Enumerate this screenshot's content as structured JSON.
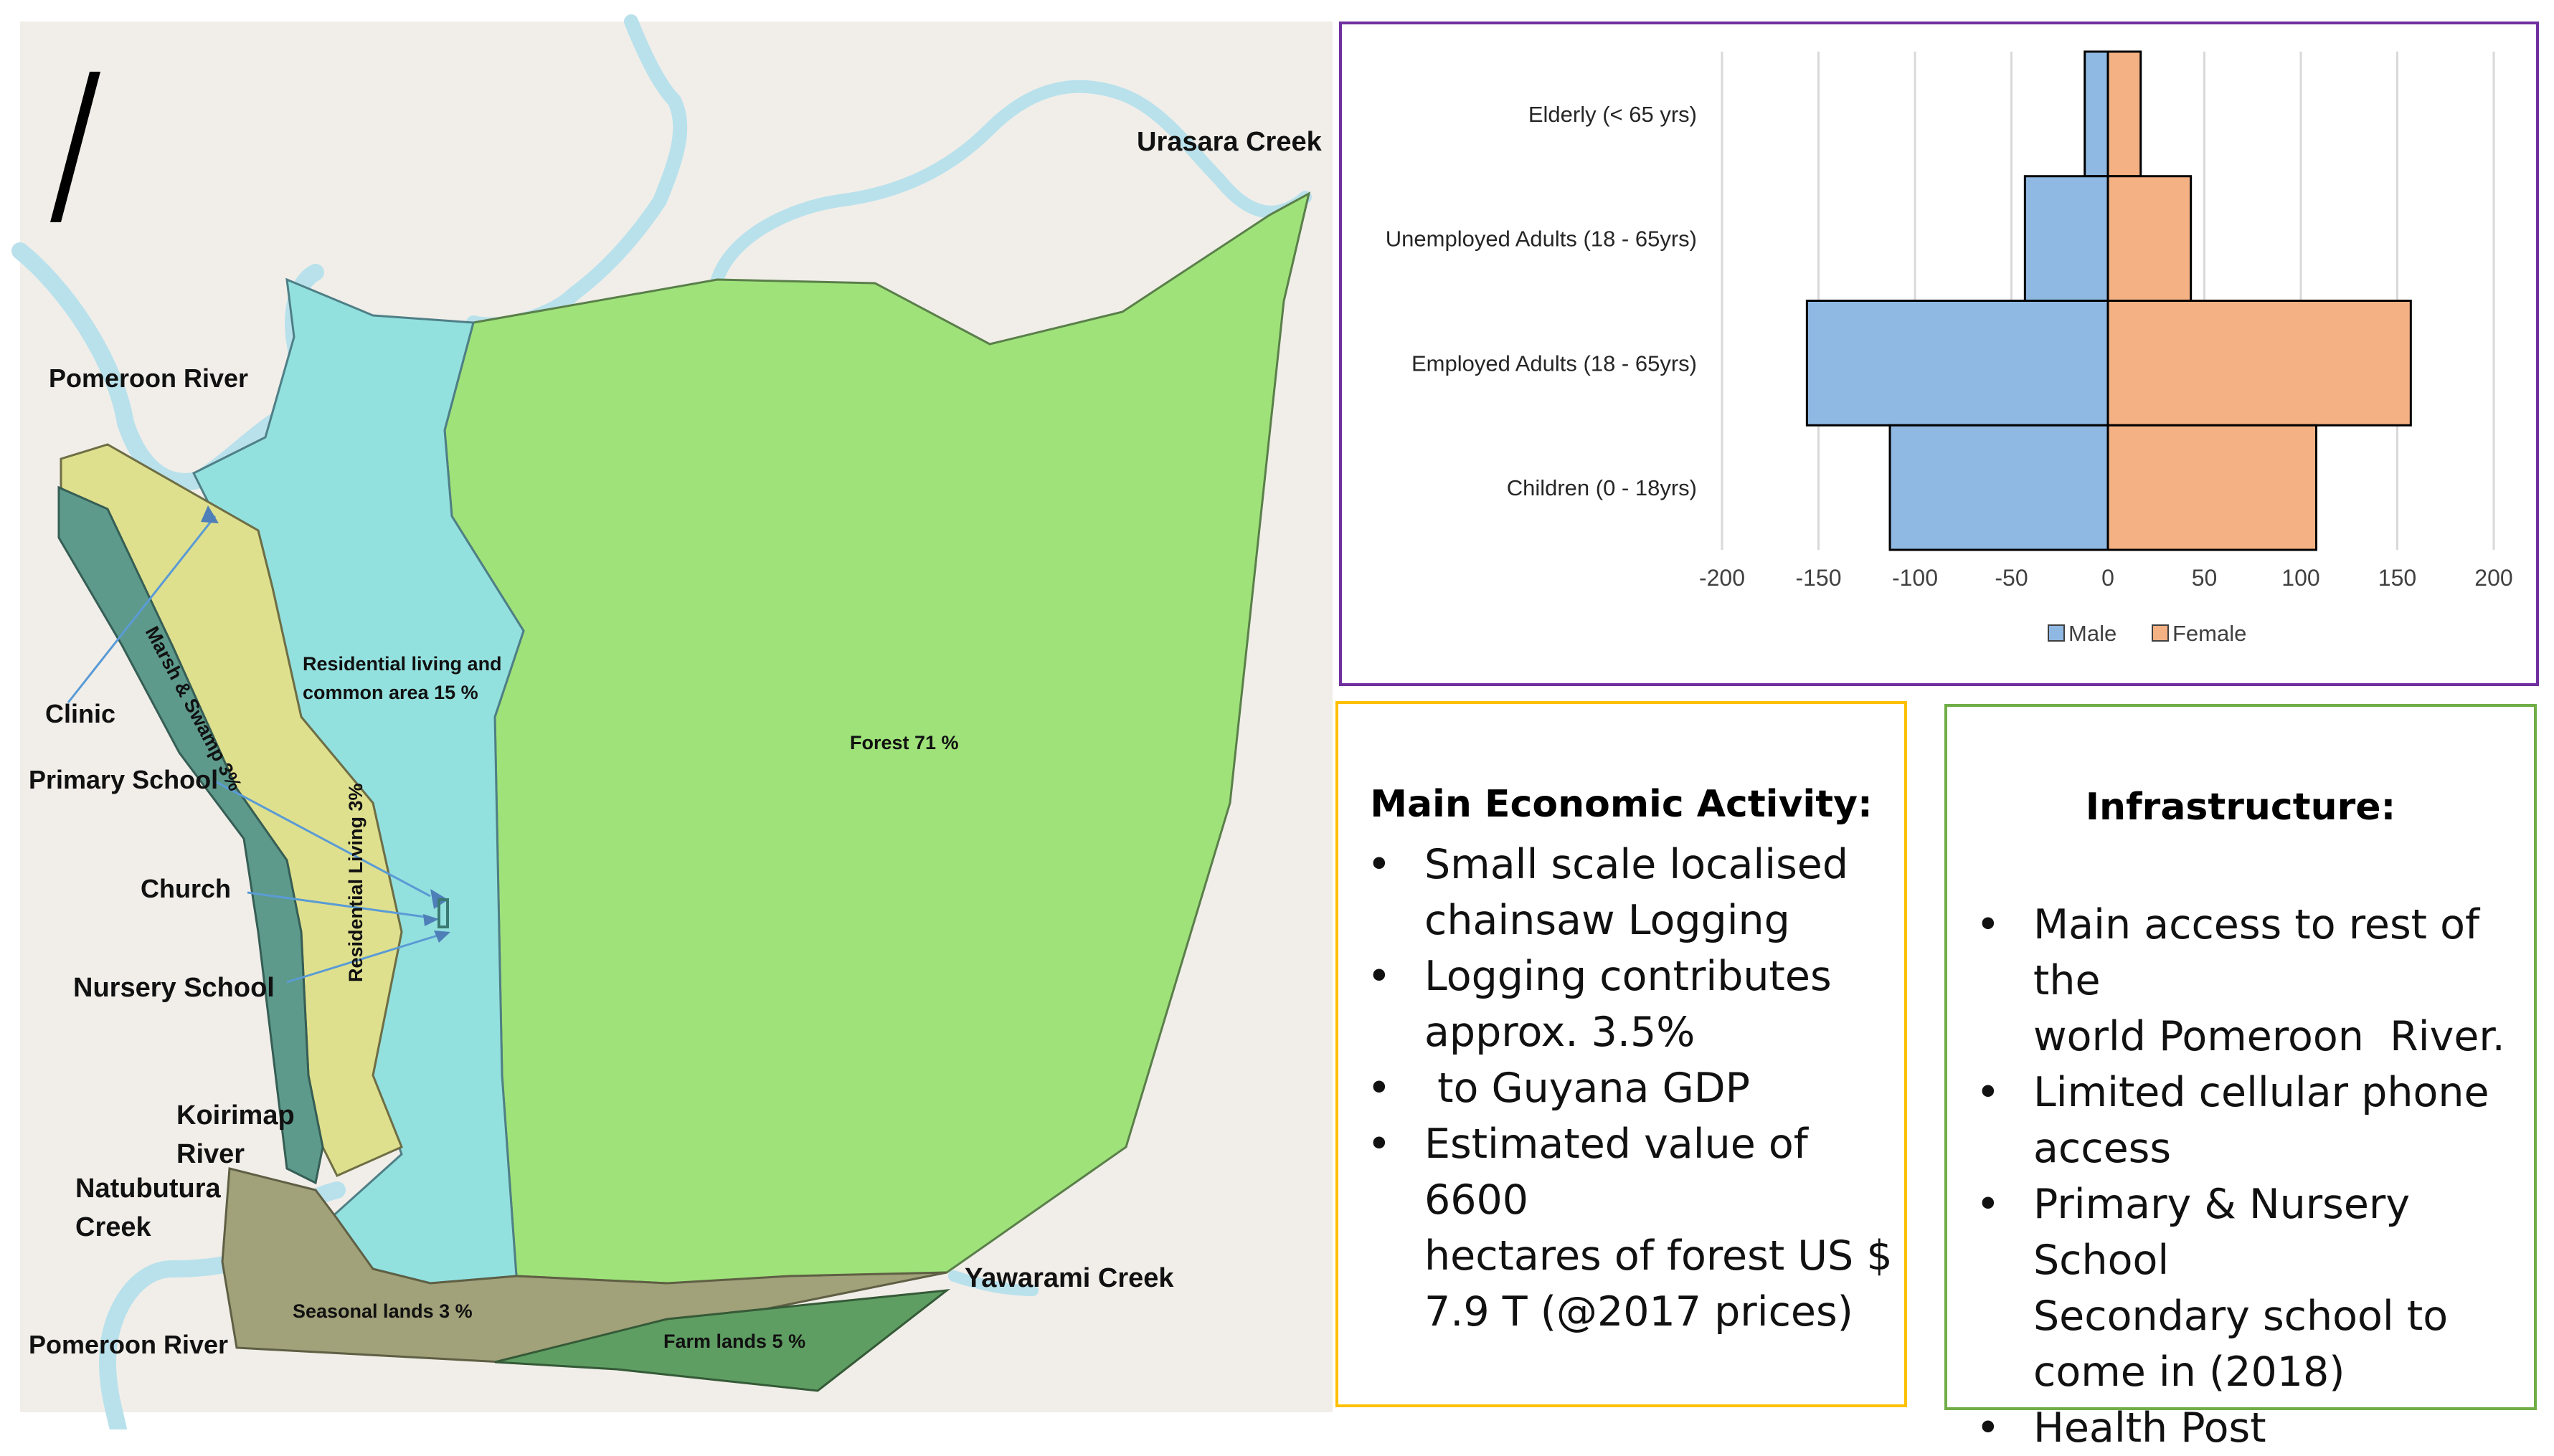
{
  "map": {
    "rivers": [
      "Pomeroon River",
      "Urasara Creek",
      "Koirimap River",
      "Natubutura Creek",
      "Yawarami Creek",
      "Pomeroon River"
    ],
    "areas": {
      "forest": "Forest 71 %",
      "residential_common": [
        "Residential living and",
        "common area 15 %"
      ],
      "residential_living": "Residential Living 3%",
      "marsh": "Marsh & Swamp 3%",
      "seasonal": "Seasonal lands 3 %",
      "farm": "Farm lands 5 %"
    },
    "facilities": [
      "Clinic",
      "Primary School",
      "Church",
      "Nursery School"
    ],
    "labels": {
      "pomeroon_top": "Pomeroon River",
      "urasara": "Urasara Creek",
      "clinic": "Clinic",
      "primary_school": "Primary School",
      "church": "Church",
      "nursery_school": "Nursery School",
      "koirimap": [
        "Koirimap",
        "River"
      ],
      "natubutura": [
        "Natubutura",
        "Creek"
      ],
      "yawarami": "Yawarami Creek",
      "pomeroon_bottom": "Pomeroon River"
    },
    "colors": {
      "forest": "#9fe27a",
      "residential_common": "#93e1df",
      "residential_living": "#dfe08e",
      "marsh": "#5d9a8b",
      "seasonal": "#a1a17a",
      "farm": "#5f9e63",
      "river": "#b9e1ec",
      "background": "#f1eee9"
    }
  },
  "chart_data": {
    "type": "bar",
    "orientation": "horizontal",
    "categories": [
      "Elderly (< 65 yrs)",
      "Unemployed Adults (18 - 65yrs)",
      "Employed Adults (18 - 65yrs)",
      "Children (0 - 18yrs)"
    ],
    "series": [
      {
        "name": "Male",
        "values": [
          -12,
          -43,
          -156,
          -113
        ],
        "color": "#8fb9e3"
      },
      {
        "name": "Female",
        "values": [
          17,
          43,
          157,
          108
        ],
        "color": "#f4b183"
      }
    ],
    "xlim": [
      -200,
      200
    ],
    "xticks": [
      "-200",
      "-150",
      "-100",
      "-50",
      "0",
      "50",
      "100",
      "150",
      "200"
    ],
    "grid": true,
    "legend_position": "bottom"
  },
  "economic": {
    "title": "Main Economic Activity:",
    "items": [
      [
        "Small scale localised",
        "chainsaw Logging"
      ],
      [
        "Logging contributes",
        "approx. 3.5%"
      ],
      [
        " to Guyana GDP"
      ],
      [
        "Estimated value of 6600",
        "hectares of forest US $",
        "7.9 T (@2017 prices)"
      ]
    ]
  },
  "infrastructure": {
    "title": "Infrastructure:",
    "items": [
      [
        "Main access to rest of the",
        "world Pomeroon  River."
      ],
      [
        "Limited cellular phone",
        "access"
      ],
      [
        "Primary & Nursery School",
        "Secondary school to",
        "come in (2018)"
      ],
      [
        "Health Post"
      ]
    ]
  }
}
